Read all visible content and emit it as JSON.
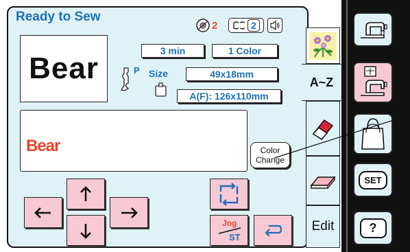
{
  "header": {
    "title": "Ready to Sew",
    "thread_count": "2",
    "spool_count": "2"
  },
  "preview": {
    "text": "Bear"
  },
  "info": {
    "time": "3 min",
    "colors": "1 Color",
    "presser_foot": "P",
    "size_label": "Size",
    "size_value": "49x18mm",
    "frame_value": "A(F): 126x110mm"
  },
  "text_box": {
    "text": "Bear"
  },
  "buttons": {
    "color_change_line1": "Color",
    "color_change_line2": "Change",
    "jog_line1": "Jog",
    "jog_line2": "ST"
  },
  "tabs": {
    "az_label": "A~Z",
    "edit_label": "Edit"
  },
  "right_panel": {
    "set_label": "SET",
    "help_label": "?"
  },
  "colors": {
    "accent": "#1e6fb8",
    "text_red": "#e8452c",
    "screen_bg": "#dff3f6",
    "button_pink": "#f6c9d4"
  },
  "icons": [
    "thread-count-icon",
    "spool-icon",
    "speaker-icon",
    "flower-icon",
    "presser-foot-icon",
    "hoop-icon",
    "eraser-icon",
    "eraser-flat-icon",
    "arrow-up-icon",
    "arrow-down-icon",
    "arrow-left-icon",
    "arrow-right-icon",
    "rotate-icon",
    "return-icon",
    "sewing-machine-icon",
    "embroidery-machine-icon",
    "bag-icon"
  ]
}
